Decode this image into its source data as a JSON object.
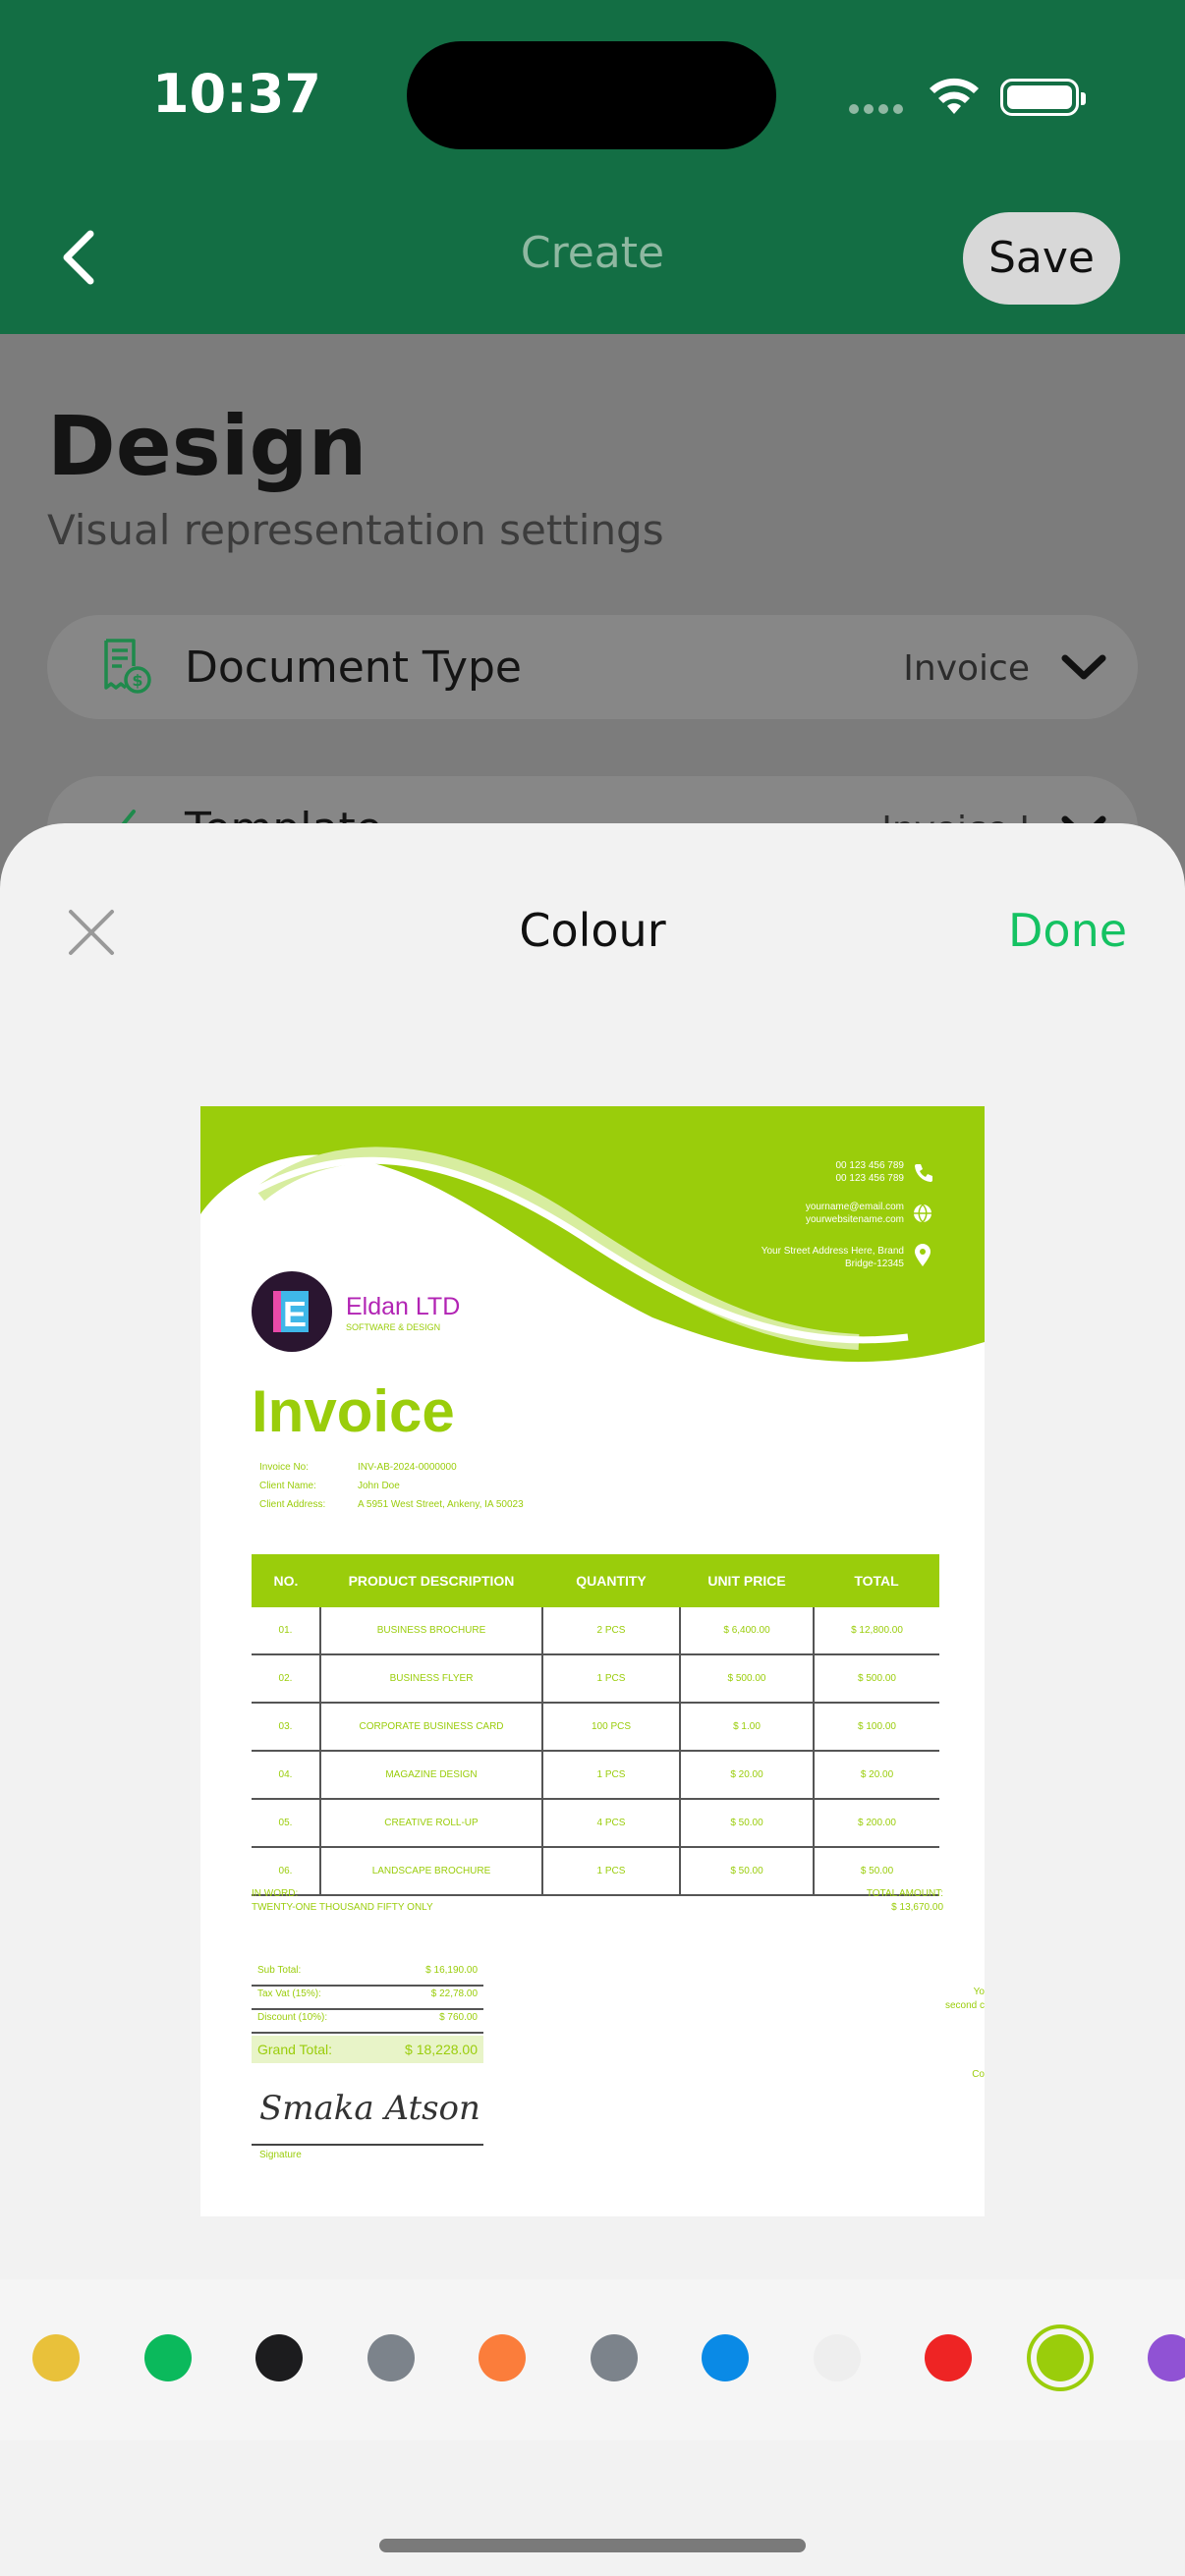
{
  "status_bar": {
    "time": "10:37"
  },
  "nav": {
    "title": "Create",
    "save_label": "Save"
  },
  "page": {
    "title": "Design",
    "subtitle": "Visual representation settings",
    "rows": [
      {
        "label": "Document Type",
        "value": "Invoice",
        "icon": "receipt-dollar-icon"
      },
      {
        "label": "Template",
        "value": "Invoice I",
        "icon": "pen-icon"
      }
    ]
  },
  "sheet": {
    "title": "Colour",
    "done_label": "Done"
  },
  "invoice": {
    "company": "Eldan LTD",
    "company_sub": "SOFTWARE & DESIGN",
    "logo_letter": "E",
    "phone1": "00 123 456 789",
    "phone2": "00 123 456 789",
    "email": "yourname@email.com",
    "website": "yourwebsitename.com",
    "address1": "Your Street Address Here, Brand",
    "address2": "Bridge-12345",
    "title": "Invoice",
    "meta": [
      {
        "label": "Invoice No:",
        "value": "INV-AB-2024-0000000"
      },
      {
        "label": "Client Name:",
        "value": "John Doe"
      },
      {
        "label": "Client Address:",
        "value": "A 5951 West Street, Ankeny, IA 50023"
      }
    ],
    "headers": [
      "NO.",
      "PRODUCT DESCRIPTION",
      "QUANTITY",
      "UNIT PRICE",
      "TOTAL"
    ],
    "rows": [
      [
        "01.",
        "BUSINESS BROCHURE",
        "2 PCS",
        "$ 6,400.00",
        "$ 12,800.00"
      ],
      [
        "02.",
        "BUSINESS FLYER",
        "1 PCS",
        "$ 500.00",
        "$ 500.00"
      ],
      [
        "03.",
        "CORPORATE BUSINESS CARD",
        "100 PCS",
        "$ 1.00",
        "$ 100.00"
      ],
      [
        "04.",
        "MAGAZINE DESIGN",
        "1 PCS",
        "$ 20.00",
        "$ 20.00"
      ],
      [
        "05.",
        "CREATIVE ROLL-UP",
        "4 PCS",
        "$ 50.00",
        "$ 200.00"
      ],
      [
        "06.",
        "LANDSCAPE BROCHURE",
        "1 PCS",
        "$ 50.00",
        "$ 50.00"
      ]
    ],
    "in_word_label": "IN WORD:",
    "in_word_value": "TWENTY-ONE THOUSAND FIFTY ONLY",
    "total_amount_label": "TOTAL AMOUNT:",
    "total_amount_value": "$ 13,670.00",
    "sub_total_label": "Sub Total:",
    "sub_total_value": "$ 16,190.00",
    "tax_label": "Tax Vat (15%):",
    "tax_value": "$ 22,78.00",
    "discount_label": "Discount (10%):",
    "discount_value": "$ 760.00",
    "grand_total_label": "Grand Total:",
    "grand_total_value": "$ 18,228.00",
    "signature_text": "Smaka Atson",
    "signature_label": "Signature",
    "cut_text_1": "Yo",
    "cut_text_2": "second c",
    "cut_text_3": "Co"
  },
  "colours": [
    {
      "name": "yellow",
      "hex": "#e9c13a"
    },
    {
      "name": "green",
      "hex": "#0bb95c"
    },
    {
      "name": "black",
      "hex": "#1c1c1e"
    },
    {
      "name": "grey",
      "hex": "#7c838b"
    },
    {
      "name": "orange",
      "hex": "#fb7d3b"
    },
    {
      "name": "slate",
      "hex": "#7c838b"
    },
    {
      "name": "blue",
      "hex": "#0a8ae6"
    },
    {
      "name": "white",
      "hex": "#eeeeee"
    },
    {
      "name": "red",
      "hex": "#ee2424"
    },
    {
      "name": "lime",
      "hex": "#9acd0b",
      "selected": true
    },
    {
      "name": "purple",
      "hex": "#9052d4"
    }
  ]
}
